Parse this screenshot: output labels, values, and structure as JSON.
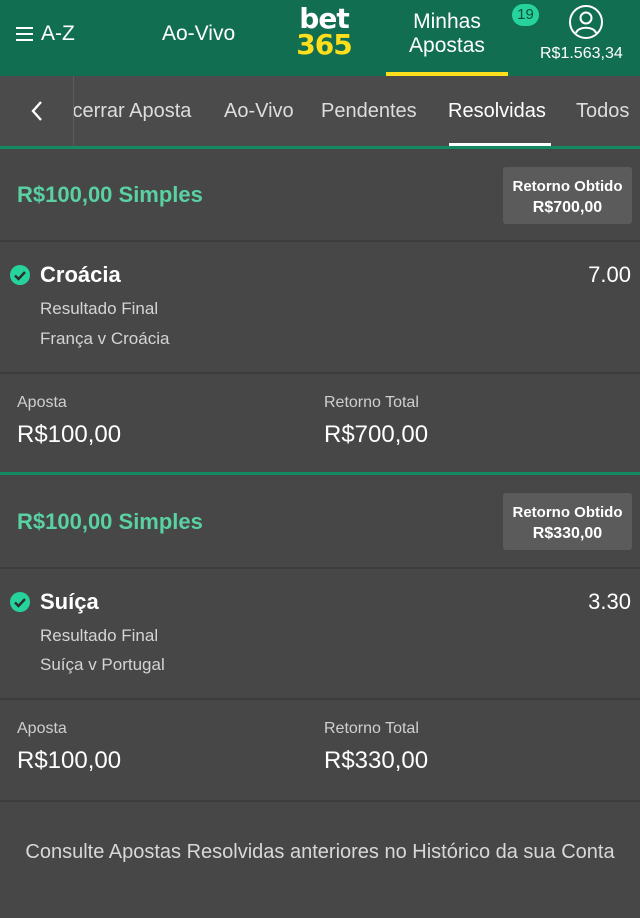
{
  "header": {
    "menu_label": "A-Z",
    "nav_live": "Ao-Vivo",
    "logo_top": "bet",
    "logo_bottom": "365",
    "my_bets_line1": "Minhas",
    "my_bets_line2": "Apostas",
    "bets_count": "19",
    "balance": "R$1.563,34"
  },
  "tabs": [
    {
      "label": "Encerrar Aposta"
    },
    {
      "label": "Ao-Vivo"
    },
    {
      "label": "Pendentes"
    },
    {
      "label": "Resolvidas",
      "active": true
    },
    {
      "label": "Todos"
    }
  ],
  "bets": [
    {
      "title": "R$100,00 Simples",
      "return_label": "Retorno Obtido",
      "return_value": "R$700,00",
      "selection": "Croácia",
      "odds": "7.00",
      "market": "Resultado Final",
      "event": "França v Croácia",
      "stake_label": "Aposta",
      "stake": "R$100,00",
      "total_return_label": "Retorno Total",
      "total_return": "R$700,00"
    },
    {
      "title": "R$100,00 Simples",
      "return_label": "Retorno Obtido",
      "return_value": "R$330,00",
      "selection": "Suíça",
      "odds": "3.30",
      "market": "Resultado Final",
      "event": "Suíça v Portugal",
      "stake_label": "Aposta",
      "stake": "R$100,00",
      "total_return_label": "Retorno Total",
      "total_return": "R$330,00"
    }
  ],
  "footer_note": "Consulte Apostas Resolvidas anteriores no Histórico da sua Conta",
  "colors": {
    "header_bg": "#126e51",
    "accent_green": "#59d1a2",
    "badge_green": "#26d39c",
    "logo_yellow": "#ffdf1b",
    "page_bg": "#474747"
  }
}
